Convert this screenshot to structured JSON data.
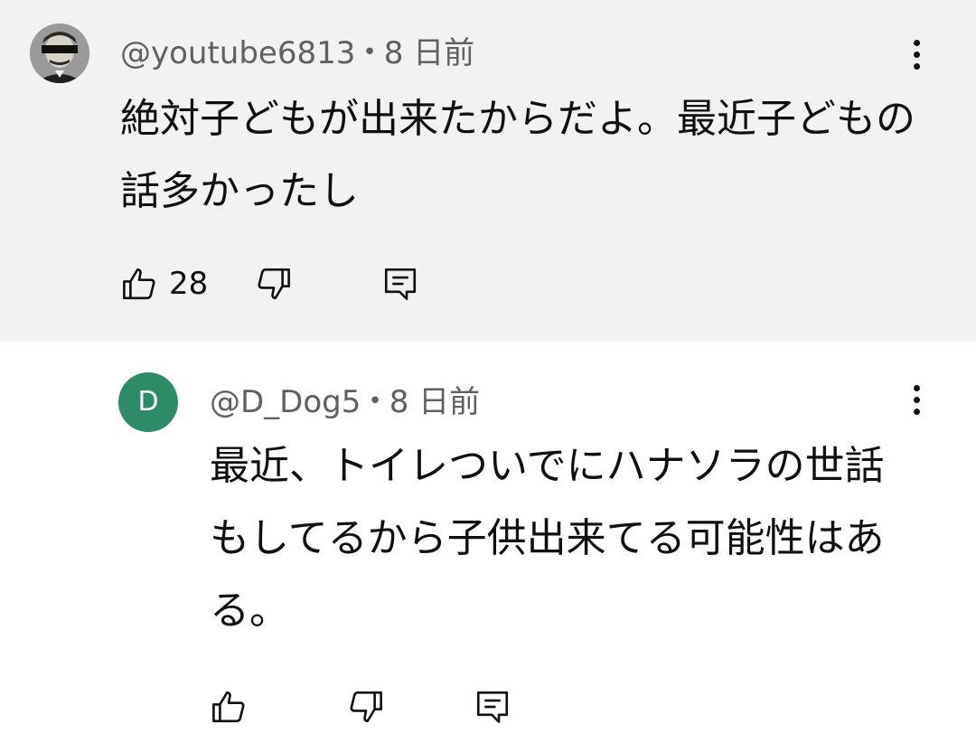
{
  "comments": [
    {
      "author": "@youtube6813",
      "separator": "•",
      "time": "8 日前",
      "text": "絶対子どもが出来たからだよ。最近子どもの話多かったし",
      "likes": "28",
      "avatar": "photo-avatar-with-censor-bar"
    },
    {
      "author": "@D_Dog5",
      "separator": "•",
      "time": "8 日前",
      "text": "最近、トイレついでにハナソラの世話もしてるから子供出来てる可能性はある。",
      "avatar_letter": "D",
      "avatar_color": "#2e8b67"
    }
  ],
  "icons": {
    "like": "thumbs-up-icon",
    "dislike": "thumbs-down-icon",
    "reply": "reply-icon",
    "menu": "more-vert-icon"
  },
  "colors": {
    "highlight_bg": "#f2f2f2",
    "meta_text": "#606060"
  }
}
